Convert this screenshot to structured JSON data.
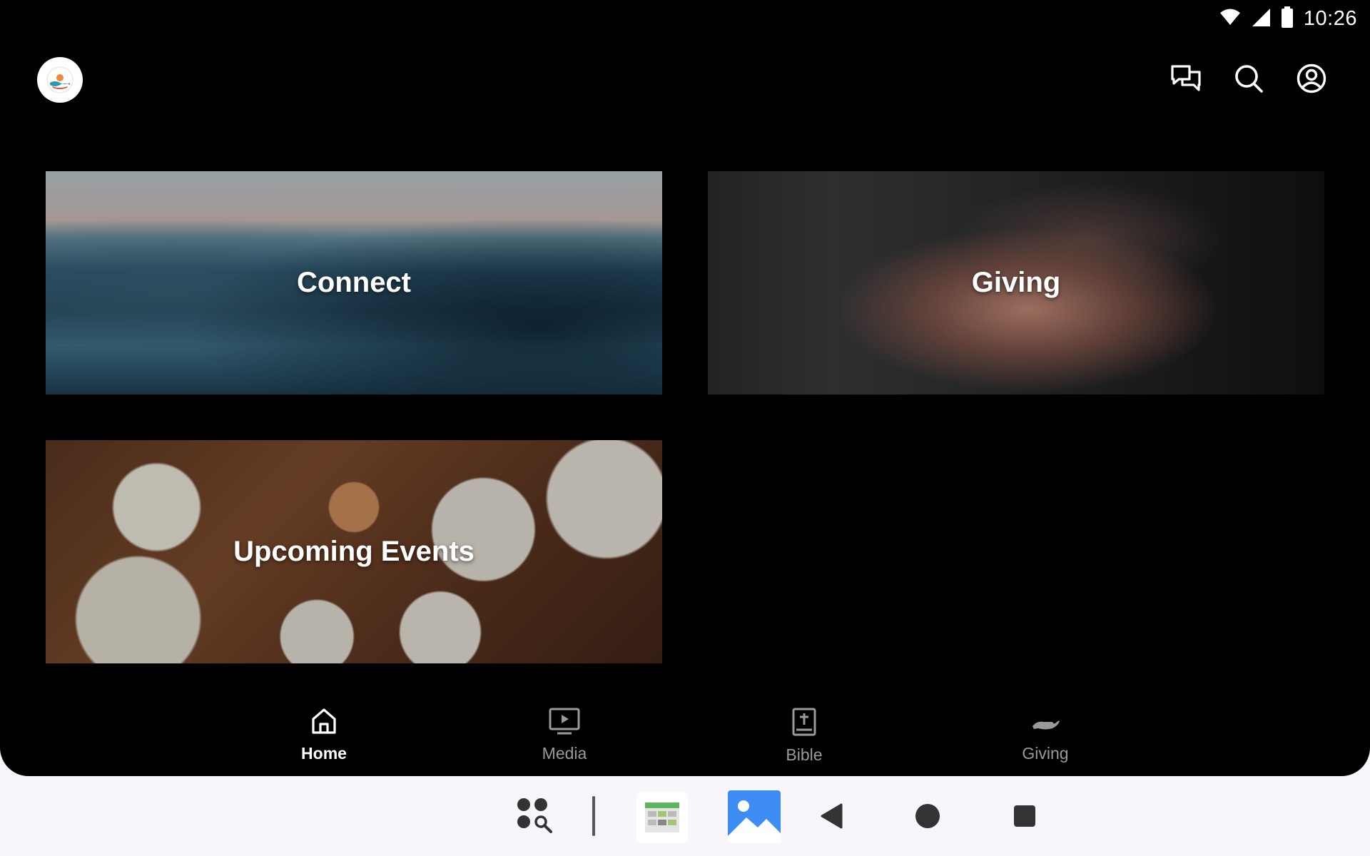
{
  "status_bar": {
    "time": "10:26",
    "icons": [
      "wifi-icon",
      "cell-signal-icon",
      "battery-icon"
    ]
  },
  "header": {
    "logo": "church-logo",
    "actions": [
      {
        "name": "chat-icon"
      },
      {
        "name": "search-icon"
      },
      {
        "name": "account-icon"
      }
    ]
  },
  "cards": [
    {
      "label": "Connect"
    },
    {
      "label": "Giving"
    },
    {
      "label": "Upcoming Events"
    }
  ],
  "bottom_nav": {
    "items": [
      {
        "label": "Home",
        "icon": "home-icon",
        "active": true
      },
      {
        "label": "Media",
        "icon": "media-icon",
        "active": false
      },
      {
        "label": "Bible",
        "icon": "bible-icon",
        "active": false
      },
      {
        "label": "Giving",
        "icon": "giving-hand-icon",
        "active": false
      }
    ]
  },
  "taskbar": {
    "items": [
      "app-drawer-search-icon",
      "calendar-app-icon",
      "gallery-app-icon",
      "back-icon",
      "home-circle-icon",
      "recents-square-icon"
    ]
  },
  "colors": {
    "app_background": "#000000",
    "active_nav": "#ffffff",
    "inactive_nav": "#9a9a9a",
    "taskbar_background": "#f8f6fb"
  }
}
